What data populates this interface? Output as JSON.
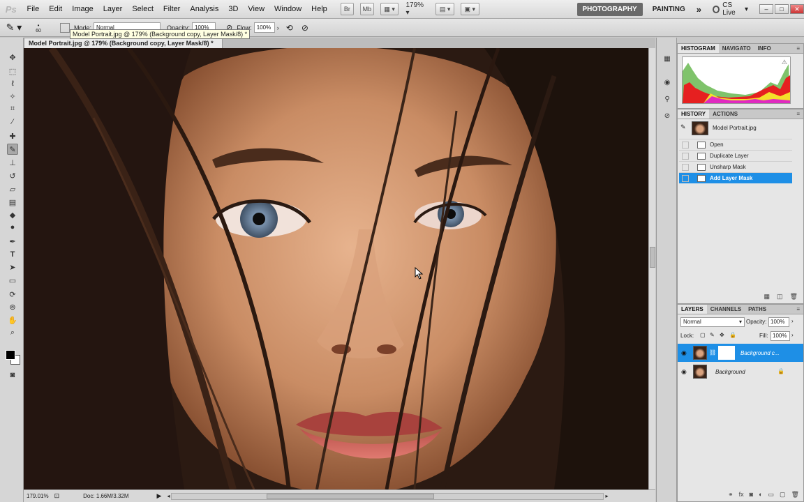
{
  "app": {
    "logo": "Ps"
  },
  "menu": [
    "File",
    "Edit",
    "Image",
    "Layer",
    "Select",
    "Filter",
    "Analysis",
    "3D",
    "View",
    "Window",
    "Help"
  ],
  "menubar": {
    "bridge_label": "Br",
    "minibridge_label": "Mb",
    "zoom": "179%",
    "workspaces": [
      "PHOTOGRAPHY",
      "PAINTING"
    ],
    "more": "»",
    "cslive": "CS Live",
    "window_controls": [
      "–",
      "□",
      "✕"
    ]
  },
  "options": {
    "brush_size": "60",
    "mode_label": "Mode:",
    "mode_value": "Normal",
    "opacity_label": "Opacity:",
    "opacity_value": "100%",
    "flow_label": "Flow:",
    "flow_value": "100%"
  },
  "tooltip": "Model Portrait.jpg @ 179% (Background copy, Layer Mask/8) *",
  "document": {
    "tab_title": "Model Portrait.jpg @ 179% (Background copy, Layer Mask/8) *",
    "close": "✕"
  },
  "status": {
    "zoom": "179.01%",
    "doc": "Doc: 1.66M/3.32M"
  },
  "histogram_panel": {
    "tabs": [
      "HISTOGRAM",
      "NAVIGATO",
      "INFO"
    ],
    "menu": "≡",
    "warning": "⚠"
  },
  "history_panel": {
    "tabs": [
      "HISTORY",
      "ACTIONS"
    ],
    "menu": "≡",
    "snapshot": "Model Portrait.jpg",
    "states": [
      "Open",
      "Duplicate Layer",
      "Unsharp Mask",
      "Add Layer Mask"
    ],
    "selected_index": 3,
    "footer_icons": [
      "▦",
      "◫",
      "🗑"
    ]
  },
  "layers_panel": {
    "tabs": [
      "LAYERS",
      "CHANNELS",
      "PATHS"
    ],
    "menu": "≡",
    "blend_mode": "Normal",
    "opacity_label": "Opacity:",
    "opacity_value": "100%",
    "lock_label": "Lock:",
    "fill_label": "Fill:",
    "fill_value": "100%",
    "layers": [
      {
        "name": "Background c...",
        "selected": true,
        "has_mask": true,
        "locked": false
      },
      {
        "name": "Background",
        "selected": false,
        "has_mask": false,
        "locked": true
      }
    ],
    "footer_icons": [
      "⚭",
      "fx",
      "◙",
      "◐",
      "▭",
      "▢",
      "🗑"
    ]
  },
  "colors": {
    "selection": "#1e8fe6",
    "workspace_active": "#6a6a6a"
  }
}
